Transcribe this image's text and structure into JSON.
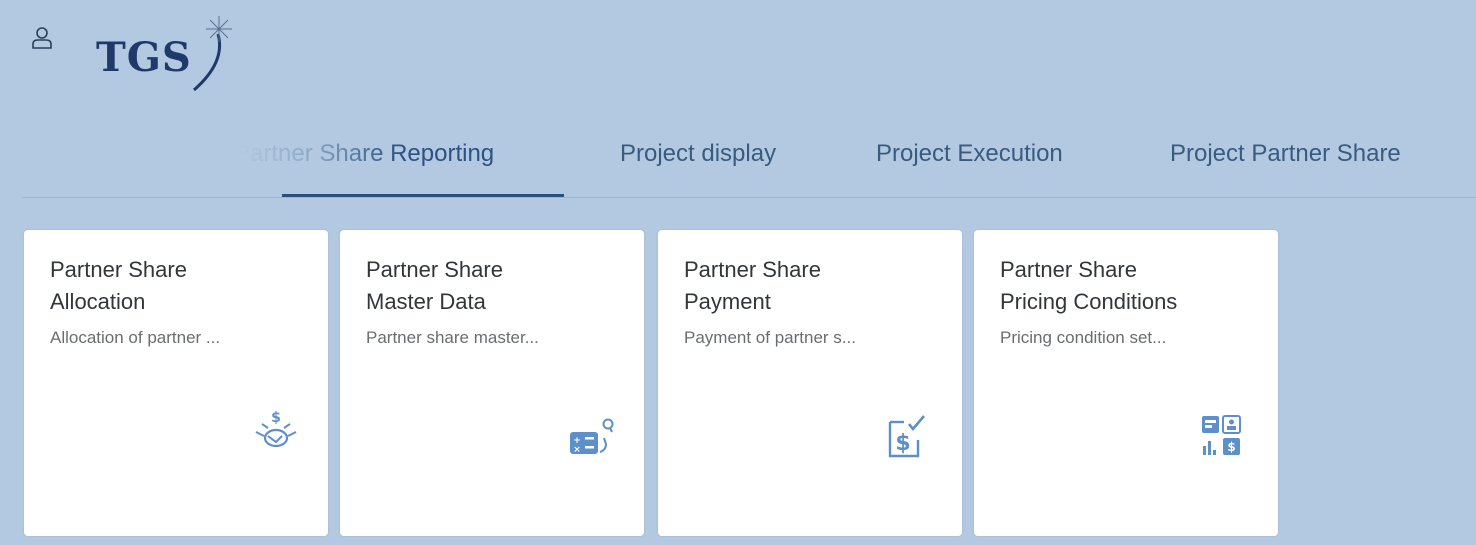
{
  "header": {
    "logo_text": "TGS",
    "user_icon": "person-icon"
  },
  "tabs": [
    {
      "label": "Partner Share Reporting",
      "active": true
    },
    {
      "label": "Project display",
      "active": false
    },
    {
      "label": "Project Execution",
      "active": false
    },
    {
      "label": "Project Partner Share",
      "active": false
    }
  ],
  "tiles": [
    {
      "title_line1": "Partner Share",
      "title_line2": "Allocation",
      "subtitle": "Allocation of partner ...",
      "icon": "handshake-dollar-icon"
    },
    {
      "title_line1": "Partner Share",
      "title_line2": "Master Data",
      "subtitle": "Partner share master...",
      "icon": "calculator-search-icon"
    },
    {
      "title_line1": "Partner Share",
      "title_line2": "Payment",
      "subtitle": "Payment of partner s...",
      "icon": "dollar-document-check-icon"
    },
    {
      "title_line1": "Partner Share",
      "title_line2": "Pricing Conditions",
      "subtitle": "Pricing condition set...",
      "icon": "pricing-dashboard-icon"
    }
  ],
  "colors": {
    "background": "#b3c9e1",
    "tab_text": "#3a5a80",
    "active_underline": "#2a4f7a",
    "icon_blue": "#5d8fc9",
    "logo_navy": "#1f3a6a"
  }
}
